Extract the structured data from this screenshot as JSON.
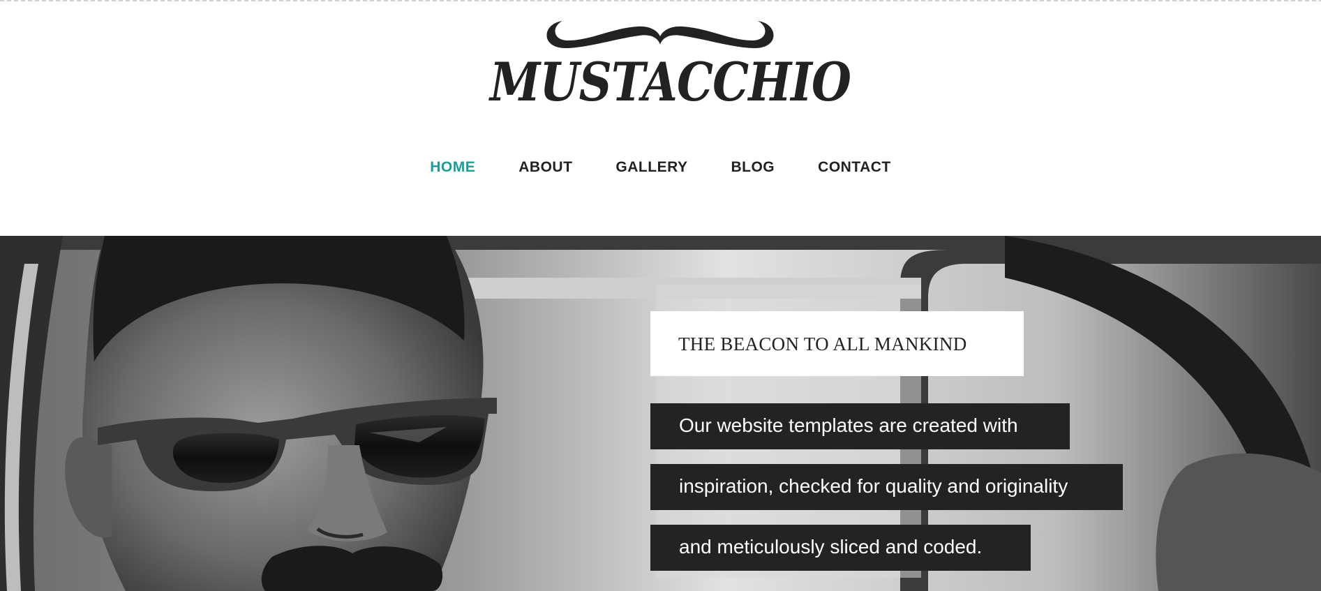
{
  "brand": {
    "logo_text": "MUSTACCHIO"
  },
  "nav": {
    "items": [
      {
        "label": "HOME",
        "active": true
      },
      {
        "label": "ABOUT",
        "active": false
      },
      {
        "label": "GALLERY",
        "active": false
      },
      {
        "label": "BLOG",
        "active": false
      },
      {
        "label": "CONTACT",
        "active": false
      }
    ],
    "active_color": "#1a9c9c",
    "text_color": "#222222"
  },
  "hero": {
    "image": "black-and-white photo of a man with sunglasses and mustache in a car",
    "tagline": "THE BEACON TO ALL MANKIND",
    "lines": [
      "Our website templates are created with",
      "inspiration, checked for quality and originality",
      "and meticulously sliced and coded."
    ]
  },
  "colors": {
    "accent": "#1a9c9c",
    "dark_box": "#232323",
    "background": "#ffffff"
  }
}
